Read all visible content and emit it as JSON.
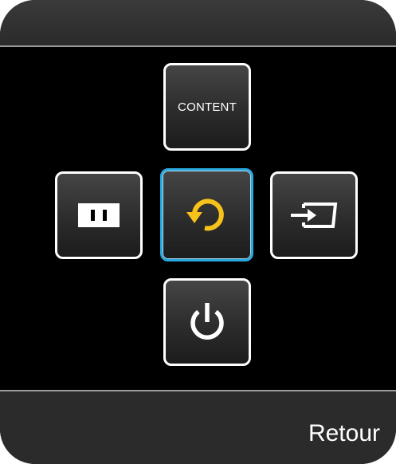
{
  "keys": {
    "content": {
      "label": "CONTENT",
      "icon": "content-text"
    },
    "menu": {
      "icon": "menu-grid-icon"
    },
    "return": {
      "icon": "return-arrow-icon",
      "selected": true
    },
    "source": {
      "icon": "source-input-icon"
    },
    "power": {
      "icon": "power-icon"
    }
  },
  "footer": {
    "back_label": "Retour"
  },
  "colors": {
    "background": "#000000",
    "bar": "#2b2b2b",
    "divider": "#9a9a9a",
    "selected_border": "#29a8df",
    "return_icon": "#f7c31a",
    "text": "#ffffff"
  }
}
